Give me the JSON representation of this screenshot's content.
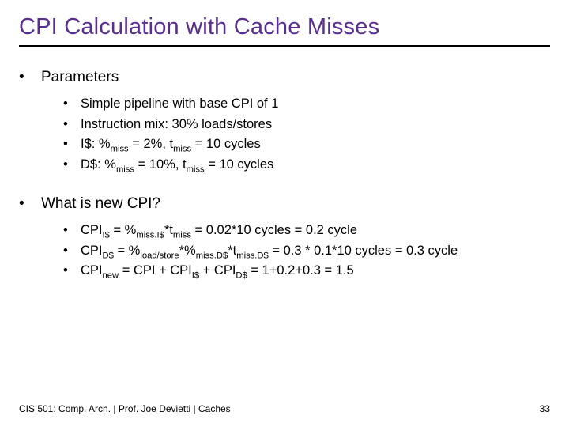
{
  "title": "CPI Calculation with Cache Misses",
  "sections": [
    {
      "heading": "Parameters",
      "items": [
        {
          "plain": "Simple pipeline with base CPI of 1"
        },
        {
          "plain": "Instruction mix: 30% loads/stores"
        },
        {
          "pre": "I$: %",
          "sub1": "miss",
          "mid1": " = 2%, t",
          "sub2": "miss",
          "post": " = 10 cycles"
        },
        {
          "pre": "D$: %",
          "sub1": "miss",
          "mid1": " = 10%, t",
          "sub2": "miss",
          "post": " = 10 cycles"
        }
      ]
    },
    {
      "heading": "What is new CPI?",
      "items": [
        {
          "pre": "CPI",
          "sub1": "I$",
          "mid1": " = %",
          "sub2": "miss.I$",
          "mid2": "*t",
          "sub3": "miss",
          "post": " = 0.02*10 cycles = 0.2 cycle"
        },
        {
          "pre": "CPI",
          "sub1": "D$",
          "mid1": " = %",
          "sub2": "load/store",
          "mid2": "*%",
          "sub3": "miss.D$",
          "mid3": "*t",
          "sub4": "miss.D$",
          "post": " = 0.3 * 0.1*10 cycles = 0.3 cycle"
        },
        {
          "pre": "CPI",
          "sub1": "new",
          "mid1": " = CPI + CPI",
          "sub2": "I$",
          "mid2": " + CPI",
          "sub3": "D$",
          "post": " = 1+0.2+0.3 = 1.5"
        }
      ]
    }
  ],
  "footer_left": "CIS 501: Comp. Arch.  |  Prof. Joe Devietti  |  Caches",
  "footer_right": "33",
  "bullet1": "•",
  "bullet2": "•"
}
